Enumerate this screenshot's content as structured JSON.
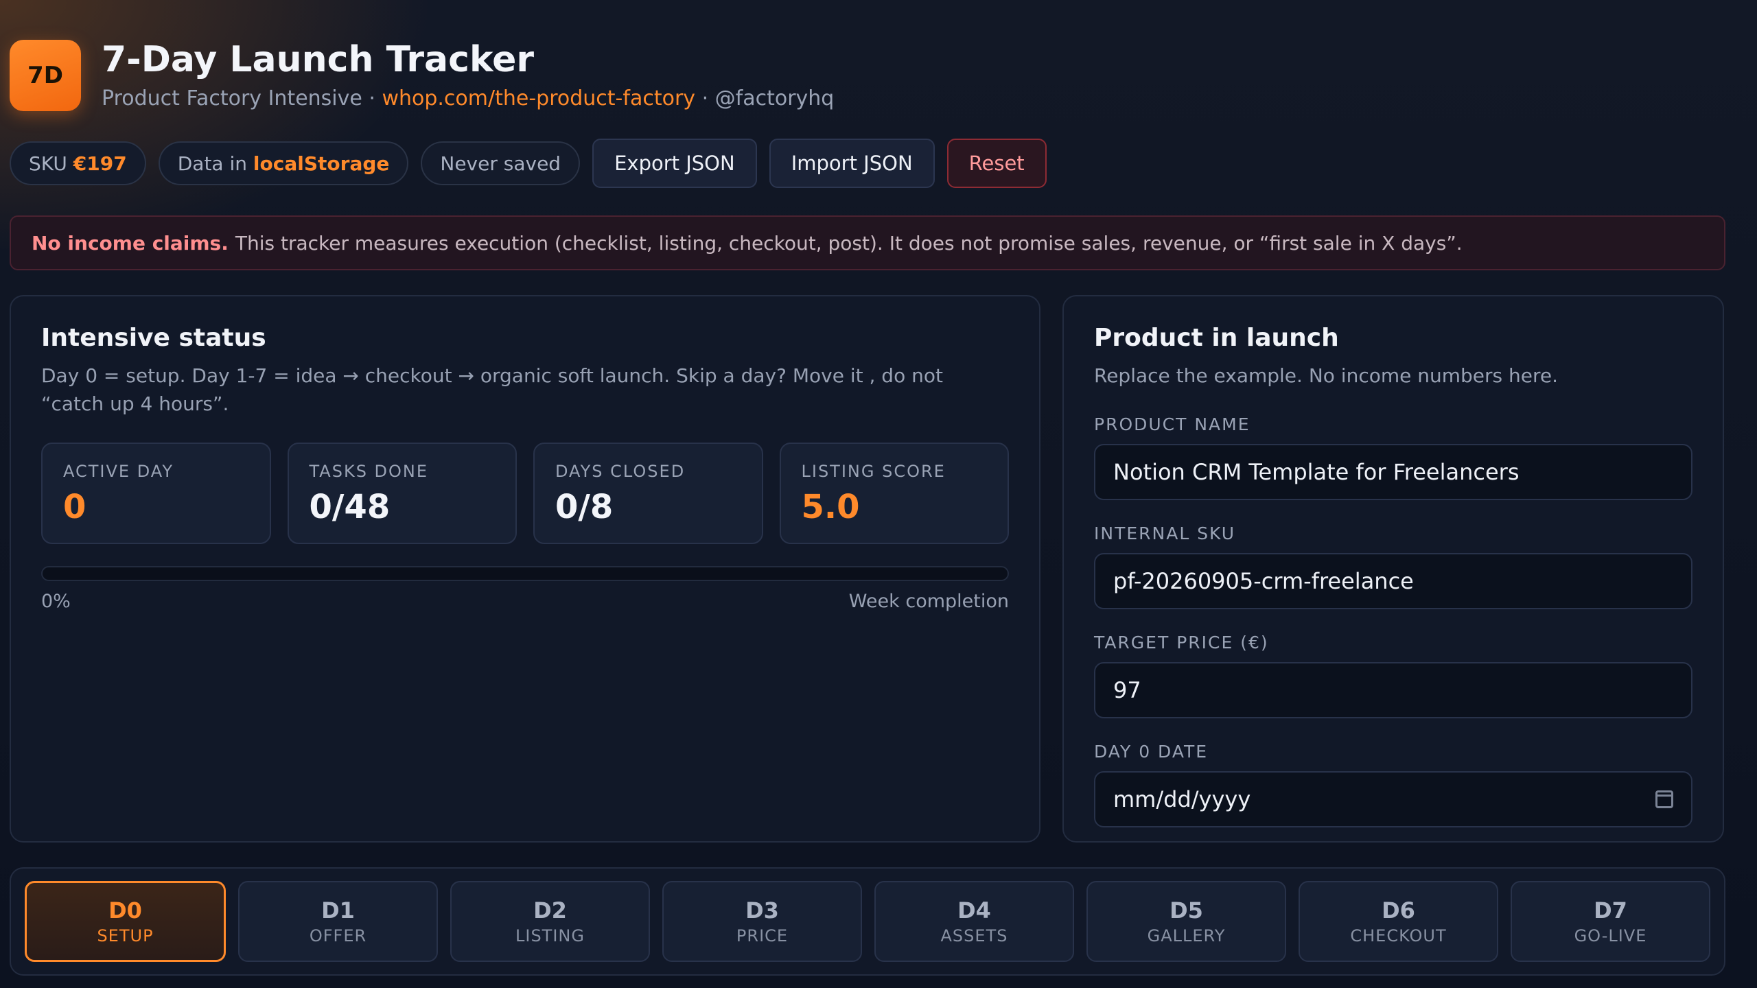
{
  "header": {
    "logo_text": "7D",
    "title": "7-Day Launch Tracker",
    "subtitle_prefix": "Product Factory Intensive · ",
    "subtitle_link": "whop.com/the-product-factory",
    "subtitle_suffix": " · @factoryhq"
  },
  "toolbar": {
    "sku_label": "SKU ",
    "sku_value": "€197",
    "storage_label": "Data in ",
    "storage_value": "localStorage",
    "save_status": "Never saved",
    "export_label": "Export JSON",
    "import_label": "Import JSON",
    "reset_label": "Reset"
  },
  "notice": {
    "bold": "No income claims.",
    "text": "This tracker measures execution (checklist, listing, checkout, post). It does not promise sales, revenue, or “first sale in X days”."
  },
  "status": {
    "title": "Intensive status",
    "description": "Day 0 = setup. Day 1-7 = idea → checkout → organic soft launch. Skip a day? Move it , do not “catch up 4 hours”.",
    "stats": [
      {
        "label": "ACTIVE DAY",
        "value": "0"
      },
      {
        "label": "TASKS DONE",
        "value": "0/48"
      },
      {
        "label": "DAYS CLOSED",
        "value": "0/8"
      },
      {
        "label": "LISTING SCORE",
        "value": "5.0"
      }
    ],
    "progress_percent": 0,
    "progress_text": "0%",
    "progress_caption": "Week completion"
  },
  "product": {
    "title": "Product in launch",
    "description": "Replace the example. No income numbers here.",
    "fields": [
      {
        "label": "PRODUCT NAME",
        "value": "Notion CRM Template for Freelancers"
      },
      {
        "label": "INTERNAL SKU",
        "value": "pf-20260905-crm-freelance"
      },
      {
        "label": "TARGET PRICE (€)",
        "value": "97"
      },
      {
        "label": "DAY 0 DATE",
        "value": "mm/dd/yyyy"
      }
    ]
  },
  "days": [
    {
      "num": "D0",
      "name": "SETUP"
    },
    {
      "num": "D1",
      "name": "OFFER"
    },
    {
      "num": "D2",
      "name": "LISTING"
    },
    {
      "num": "D3",
      "name": "PRICE"
    },
    {
      "num": "D4",
      "name": "ASSETS"
    },
    {
      "num": "D5",
      "name": "GALLERY"
    },
    {
      "num": "D6",
      "name": "CHECKOUT"
    },
    {
      "num": "D7",
      "name": "GO-LIVE"
    }
  ],
  "colors": {
    "accent": "#ff8a2b",
    "danger": "#ff8f8f"
  }
}
